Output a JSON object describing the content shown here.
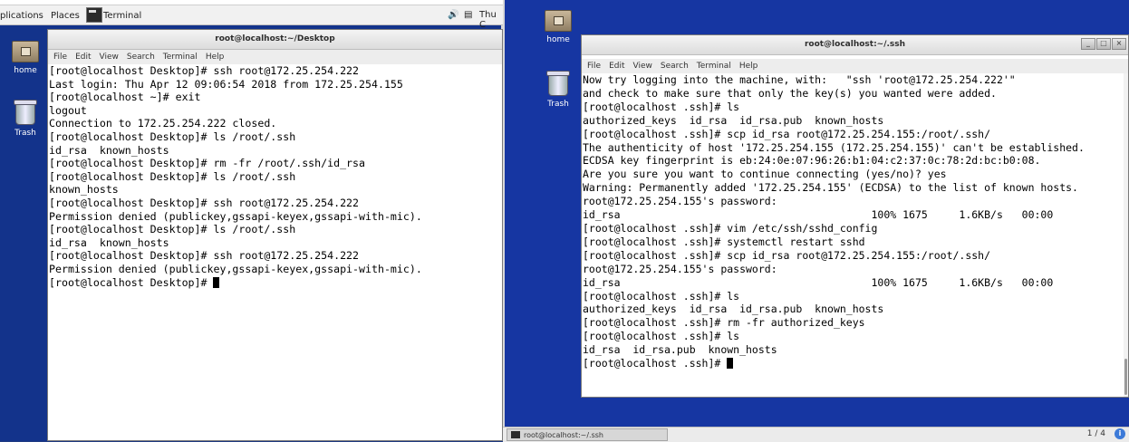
{
  "top_panel": {
    "applications": "plications",
    "places": "Places",
    "task": "Terminal",
    "volume_icon": "speaker-icon",
    "clock": "Thu C"
  },
  "desktop_left": {
    "home_label": "home",
    "trash_label": "Trash"
  },
  "desktop_right": {
    "home_label": "home",
    "trash_label": "Trash"
  },
  "term_left": {
    "title": "root@localhost:~/Desktop",
    "menu": [
      "File",
      "Edit",
      "View",
      "Search",
      "Terminal",
      "Help"
    ],
    "lines": [
      "[root@localhost Desktop]# ssh root@172.25.254.222",
      "Last login: Thu Apr 12 09:06:54 2018 from 172.25.254.155",
      "[root@localhost ~]# exit",
      "logout",
      "Connection to 172.25.254.222 closed.",
      "[root@localhost Desktop]# ls /root/.ssh",
      "id_rsa  known_hosts",
      "[root@localhost Desktop]# rm -fr /root/.ssh/id_rsa",
      "[root@localhost Desktop]# ls /root/.ssh",
      "known_hosts",
      "[root@localhost Desktop]# ssh root@172.25.254.222",
      "Permission denied (publickey,gssapi-keyex,gssapi-with-mic).",
      "[root@localhost Desktop]# ls /root/.ssh",
      "id_rsa  known_hosts",
      "[root@localhost Desktop]# ssh root@172.25.254.222",
      "Permission denied (publickey,gssapi-keyex,gssapi-with-mic)."
    ],
    "prompt": "[root@localhost Desktop]# "
  },
  "term_right": {
    "title": "root@localhost:~/.ssh",
    "menu": [
      "File",
      "Edit",
      "View",
      "Search",
      "Terminal",
      "Help"
    ],
    "lines": [
      "",
      "Now try logging into the machine, with:   \"ssh 'root@172.25.254.222'\"",
      "and check to make sure that only the key(s) you wanted were added.",
      "",
      "[root@localhost .ssh]# ls",
      "authorized_keys  id_rsa  id_rsa.pub  known_hosts",
      "[root@localhost .ssh]# scp id_rsa root@172.25.254.155:/root/.ssh/",
      "The authenticity of host '172.25.254.155 (172.25.254.155)' can't be established.",
      "ECDSA key fingerprint is eb:24:0e:07:96:26:b1:04:c2:37:0c:78:2d:bc:b0:08.",
      "Are you sure you want to continue connecting (yes/no)? yes",
      "Warning: Permanently added '172.25.254.155' (ECDSA) to the list of known hosts.",
      "root@172.25.254.155's password:",
      "id_rsa                                        100% 1675     1.6KB/s   00:00",
      "[root@localhost .ssh]# vim /etc/ssh/sshd_config",
      "[root@localhost .ssh]# systemctl restart sshd",
      "[root@localhost .ssh]# scp id_rsa root@172.25.254.155:/root/.ssh/",
      "root@172.25.254.155's password:",
      "id_rsa                                        100% 1675     1.6KB/s   00:00",
      "[root@localhost .ssh]# ls",
      "authorized_keys  id_rsa  id_rsa.pub  known_hosts",
      "[root@localhost .ssh]# rm -fr authorized_keys",
      "[root@localhost .ssh]# ls",
      "id_rsa  id_rsa.pub  known_hosts"
    ],
    "prompt": "[root@localhost .ssh]# "
  },
  "bottom_bar": {
    "task": "root@localhost:~/.ssh",
    "pager": "1 / 4",
    "info_glyph": "i"
  }
}
